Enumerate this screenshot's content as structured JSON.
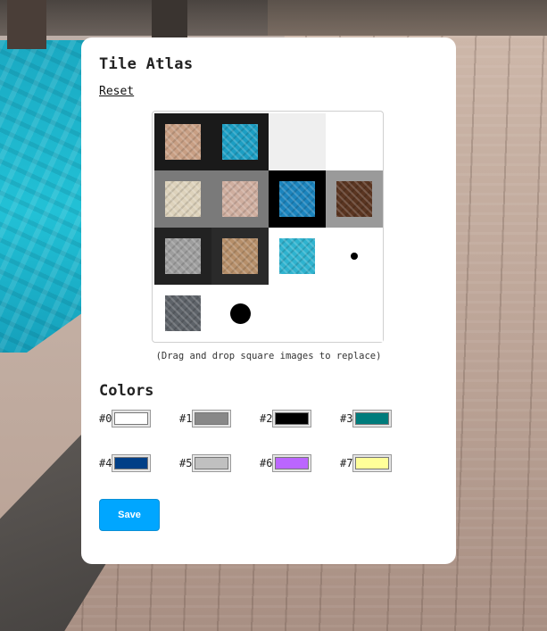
{
  "panel": {
    "title": "Tile Atlas",
    "reset_label": "Reset",
    "hint": "(Drag and drop square images to replace)",
    "colors_title": "Colors",
    "save_label": "Save"
  },
  "atlas": {
    "tiles": [
      {
        "name": "wood-floor",
        "bg": "#1a1a1a",
        "tex": "#c89f84"
      },
      {
        "name": "water",
        "bg": "#1a1a1a",
        "tex": "#1c9ec3"
      },
      {
        "name": "empty",
        "bg": "#efefef",
        "tex": null
      },
      {
        "name": "empty",
        "bg": "#ffffff",
        "tex": null
      },
      {
        "name": "birch-wood",
        "bg": "#7a7a7a",
        "tex": "#ddd2bb"
      },
      {
        "name": "pink-wood",
        "bg": "#7a7a7a",
        "tex": "#cfae9f"
      },
      {
        "name": "deep-water",
        "bg": "#000000",
        "tex": "#1b84bd"
      },
      {
        "name": "dark-wood",
        "bg": "#9a9a9a",
        "tex": "#5a3521"
      },
      {
        "name": "grey-planks",
        "bg": "#222222",
        "tex": "#9e9e9e"
      },
      {
        "name": "light-wood",
        "bg": "#2a2a2a",
        "tex": "#b68f6a"
      },
      {
        "name": "shallow-water",
        "bg": "#ffffff",
        "tex": "#2fb3cf"
      },
      {
        "name": "small-dot",
        "bg": "#ffffff",
        "tex": null,
        "dot": 8
      },
      {
        "name": "striped-metal",
        "bg": "#ffffff",
        "tex": "#5d6268"
      },
      {
        "name": "large-dot",
        "bg": "#ffffff",
        "tex": null,
        "dot": 23
      },
      {
        "name": "empty",
        "bg": "#ffffff",
        "tex": null
      },
      {
        "name": "empty",
        "bg": "#ffffff",
        "tex": null
      }
    ]
  },
  "colors": [
    {
      "label": "#0",
      "value": "#ffffff"
    },
    {
      "label": "#1",
      "value": "#888888"
    },
    {
      "label": "#2",
      "value": "#000000"
    },
    {
      "label": "#3",
      "value": "#007c7c"
    },
    {
      "label": "#4",
      "value": "#003f87"
    },
    {
      "label": "#5",
      "value": "#c0c0c0"
    },
    {
      "label": "#6",
      "value": "#bb66ff"
    },
    {
      "label": "#7",
      "value": "#ffff99"
    }
  ]
}
